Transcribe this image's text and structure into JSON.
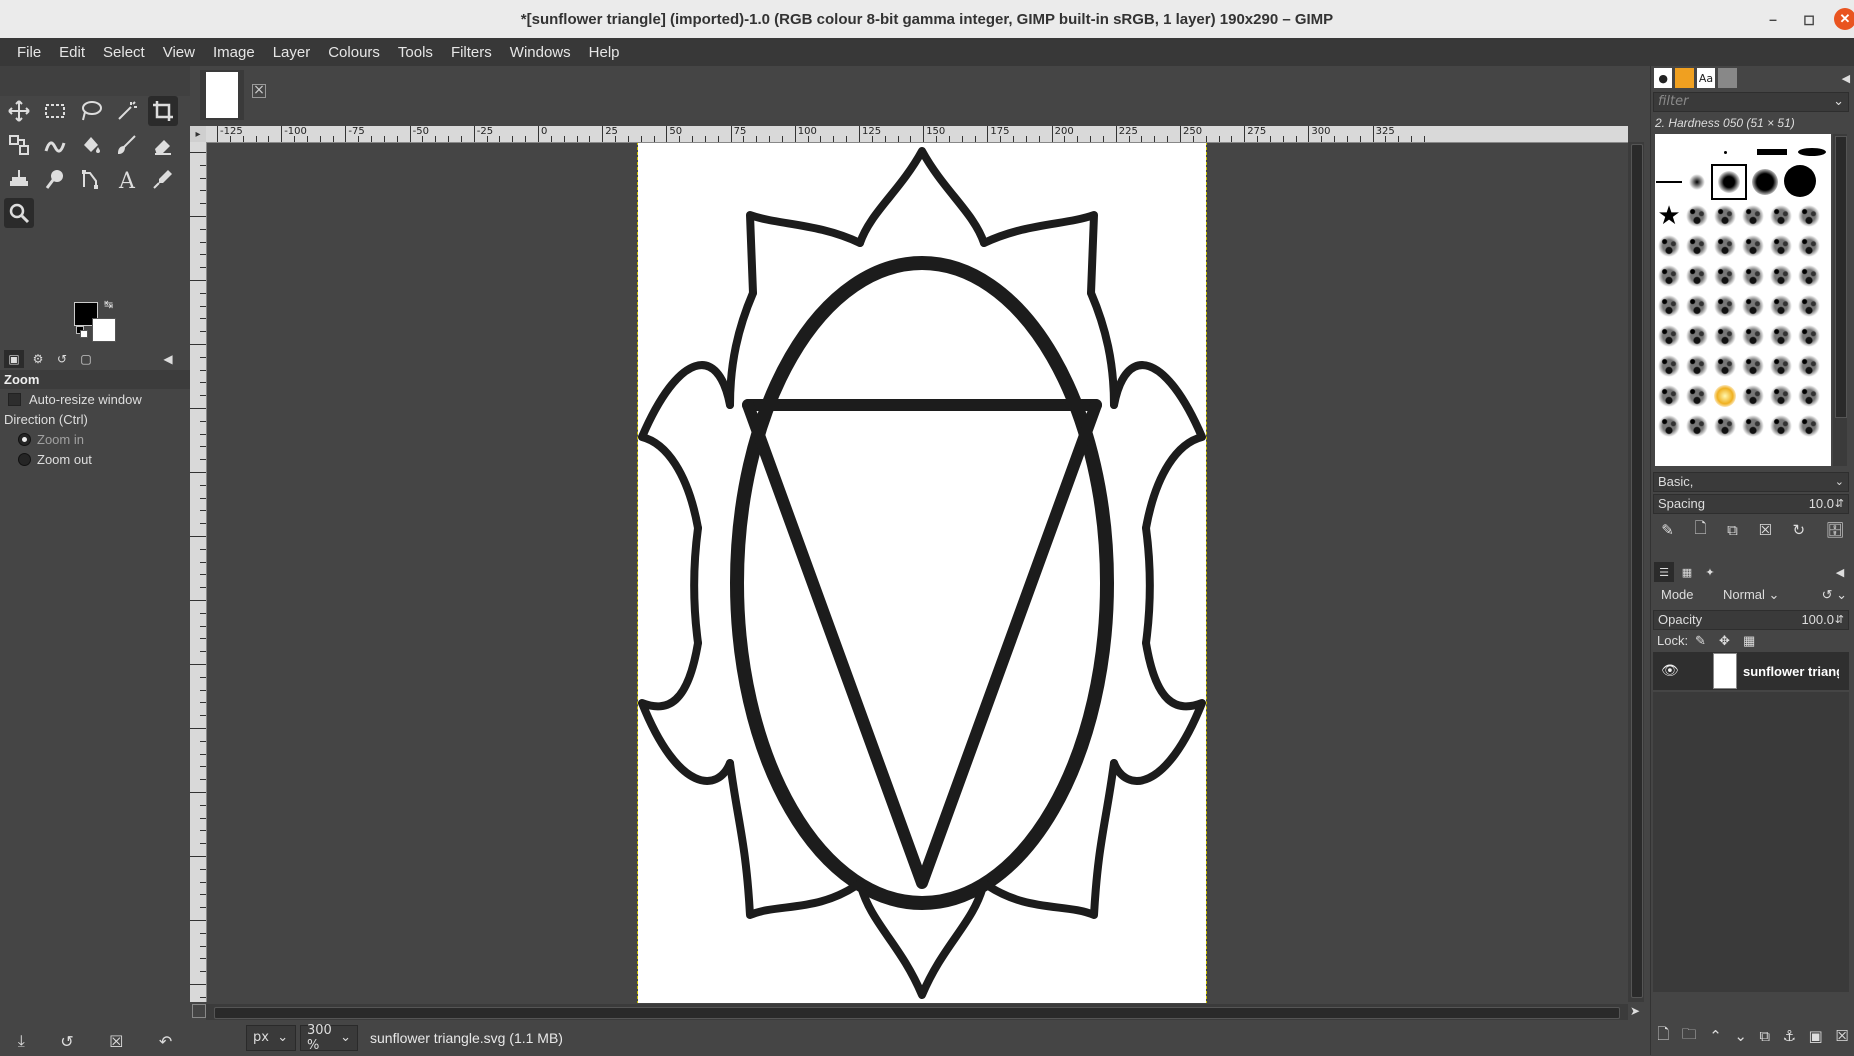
{
  "window": {
    "title": "*[sunflower triangle] (imported)-1.0 (RGB colour 8-bit gamma integer, GIMP built-in sRGB, 1 layer) 190x290 – GIMP",
    "minimize_icon": "minimize-icon",
    "maximize_icon": "maximize-icon",
    "close_icon": "close-icon"
  },
  "menu": [
    "File",
    "Edit",
    "Select",
    "View",
    "Image",
    "Layer",
    "Colours",
    "Tools",
    "Filters",
    "Windows",
    "Help"
  ],
  "toolbox": {
    "tools": [
      "move-tool-icon",
      "rect-select-icon",
      "free-select-icon",
      "fuzzy-select-icon",
      "crop-icon",
      "unified-transform-icon",
      "warp-transform-icon",
      "bucket-fill-icon",
      "paintbrush-icon",
      "eraser-icon",
      "clone-icon",
      "smudge-icon",
      "paths-icon",
      "text-icon",
      "color-picker-icon",
      "zoom-icon"
    ],
    "fg_color": "#000000",
    "bg_color": "#ffffff"
  },
  "tool_options": {
    "title": "Zoom",
    "auto_resize": "Auto-resize window",
    "direction_label": "Direction  (Ctrl)",
    "zoom_in": "Zoom in",
    "zoom_out": "Zoom out",
    "selected_direction": "Zoom in"
  },
  "ruler": {
    "h_labels": [
      "-125",
      "-100",
      "-75",
      "-50",
      "-25",
      "0",
      "25",
      "50",
      "75",
      "100",
      "125",
      "150",
      "175",
      "200",
      "225",
      "250",
      "275",
      "300",
      "325"
    ]
  },
  "status": {
    "unit": "px",
    "zoom": "300 %",
    "message": "sunflower triangle.svg (1.1 MB)"
  },
  "brushes": {
    "filter_placeholder": "filter",
    "selected_brush": "2. Hardness 050 (51 × 51)",
    "tag": "Basic,",
    "spacing_label": "Spacing",
    "spacing_value": "10.0"
  },
  "layers": {
    "mode_label": "Mode",
    "mode_value": "Normal",
    "opacity_label": "Opacity",
    "opacity_value": "100.0",
    "lock_label": "Lock:",
    "layer_name": "sunflower triangle"
  }
}
